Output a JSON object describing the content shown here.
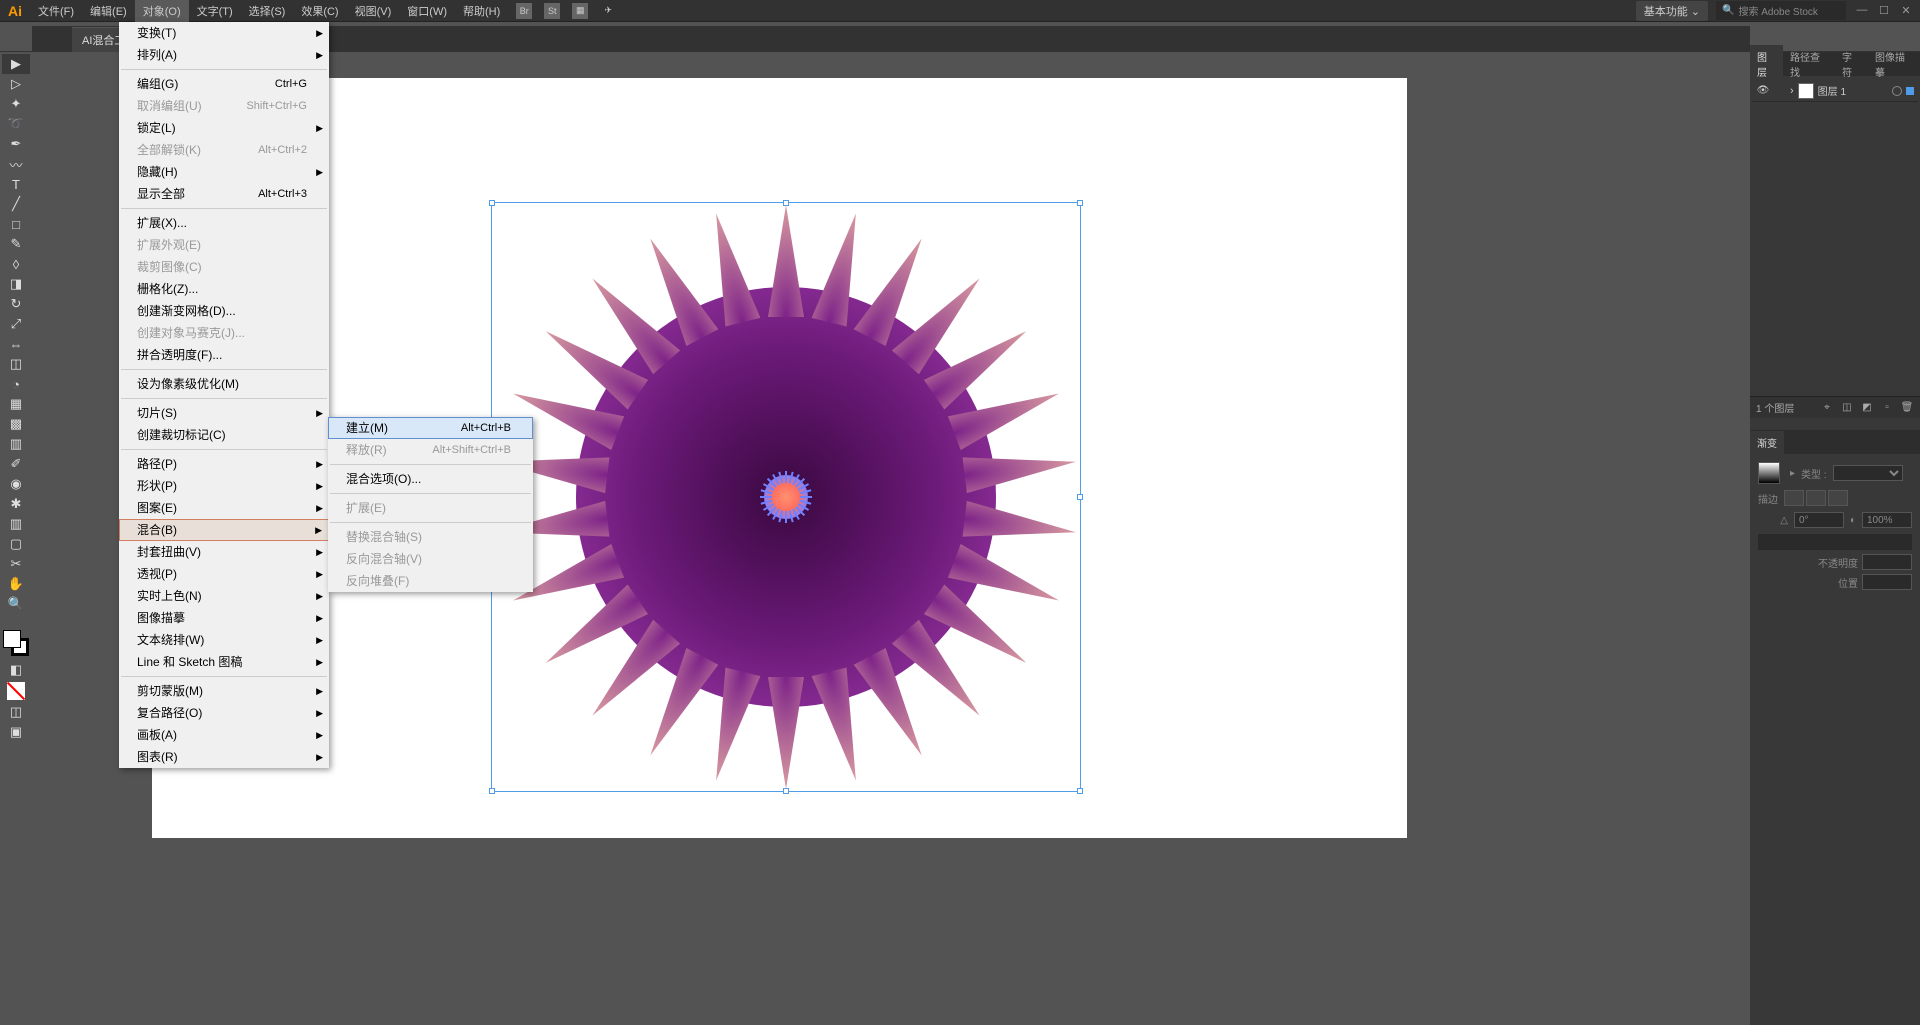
{
  "app": {
    "logo": "Ai"
  },
  "menubar": [
    "文件(F)",
    "编辑(E)",
    "对象(O)",
    "文字(T)",
    "选择(S)",
    "效果(C)",
    "视图(V)",
    "窗口(W)",
    "帮助(H)"
  ],
  "menubar_active_index": 2,
  "topbar_icons": [
    "Br",
    "St"
  ],
  "workspace": "基本功能",
  "search_placeholder": "搜索 Adobe Stock",
  "doc_tab": "AI混合工具.ai* @",
  "object_menu": [
    {
      "label": "变换(T)",
      "sub": true
    },
    {
      "label": "排列(A)",
      "sub": true
    },
    {
      "sep": true
    },
    {
      "label": "编组(G)",
      "shortcut": "Ctrl+G"
    },
    {
      "label": "取消编组(U)",
      "shortcut": "Shift+Ctrl+G",
      "disabled": true
    },
    {
      "label": "锁定(L)",
      "sub": true
    },
    {
      "label": "全部解锁(K)",
      "shortcut": "Alt+Ctrl+2",
      "disabled": true
    },
    {
      "label": "隐藏(H)",
      "sub": true
    },
    {
      "label": "显示全部",
      "shortcut": "Alt+Ctrl+3"
    },
    {
      "sep": true
    },
    {
      "label": "扩展(X)..."
    },
    {
      "label": "扩展外观(E)",
      "disabled": true
    },
    {
      "label": "裁剪图像(C)",
      "disabled": true
    },
    {
      "label": "栅格化(Z)..."
    },
    {
      "label": "创建渐变网格(D)..."
    },
    {
      "label": "创建对象马赛克(J)...",
      "disabled": true
    },
    {
      "label": "拼合透明度(F)..."
    },
    {
      "sep": true
    },
    {
      "label": "设为像素级优化(M)"
    },
    {
      "sep": true
    },
    {
      "label": "切片(S)",
      "sub": true
    },
    {
      "label": "创建裁切标记(C)"
    },
    {
      "sep": true
    },
    {
      "label": "路径(P)",
      "sub": true
    },
    {
      "label": "形状(P)",
      "sub": true
    },
    {
      "label": "图案(E)",
      "sub": true
    },
    {
      "label": "混合(B)",
      "sub": true,
      "highlighted": true
    },
    {
      "label": "封套扭曲(V)",
      "sub": true
    },
    {
      "label": "透视(P)",
      "sub": true
    },
    {
      "label": "实时上色(N)",
      "sub": true
    },
    {
      "label": "图像描摹",
      "sub": true
    },
    {
      "label": "文本绕排(W)",
      "sub": true
    },
    {
      "label": "Line 和 Sketch 图稿",
      "sub": true
    },
    {
      "sep": true
    },
    {
      "label": "剪切蒙版(M)",
      "sub": true
    },
    {
      "label": "复合路径(O)",
      "sub": true
    },
    {
      "label": "画板(A)",
      "sub": true
    },
    {
      "label": "图表(R)",
      "sub": true
    }
  ],
  "blend_submenu": [
    {
      "label": "建立(M)",
      "shortcut": "Alt+Ctrl+B",
      "highlighted": true
    },
    {
      "label": "释放(R)",
      "shortcut": "Alt+Shift+Ctrl+B",
      "disabled": true
    },
    {
      "sep": true
    },
    {
      "label": "混合选项(O)..."
    },
    {
      "sep": true
    },
    {
      "label": "扩展(E)",
      "disabled": true
    },
    {
      "sep": true
    },
    {
      "label": "替换混合轴(S)",
      "disabled": true
    },
    {
      "label": "反向混合轴(V)",
      "disabled": true
    },
    {
      "label": "反向堆叠(F)",
      "disabled": true
    }
  ],
  "panels": {
    "tabs": [
      "图层",
      "路径查找",
      "字符",
      "图像描摹"
    ],
    "active_tab": 0,
    "layer": {
      "name": "图层 1"
    },
    "footer_count": "1 个图层",
    "gradient": {
      "title": "渐变",
      "type_label": "类型 :",
      "stroke_label": "描边",
      "angle_value": "0°",
      "ratio_value": "100%",
      "opacity_label": "不透明度",
      "position_label": "位置"
    }
  },
  "tools": [
    "▶",
    "▷",
    "✎",
    "✏",
    "T",
    "/",
    "□",
    "✂",
    "↻",
    "◐",
    "▦",
    "◫",
    "✱",
    "◉",
    "◢",
    "▤",
    "|||",
    "[]",
    "✋",
    "◯"
  ]
}
